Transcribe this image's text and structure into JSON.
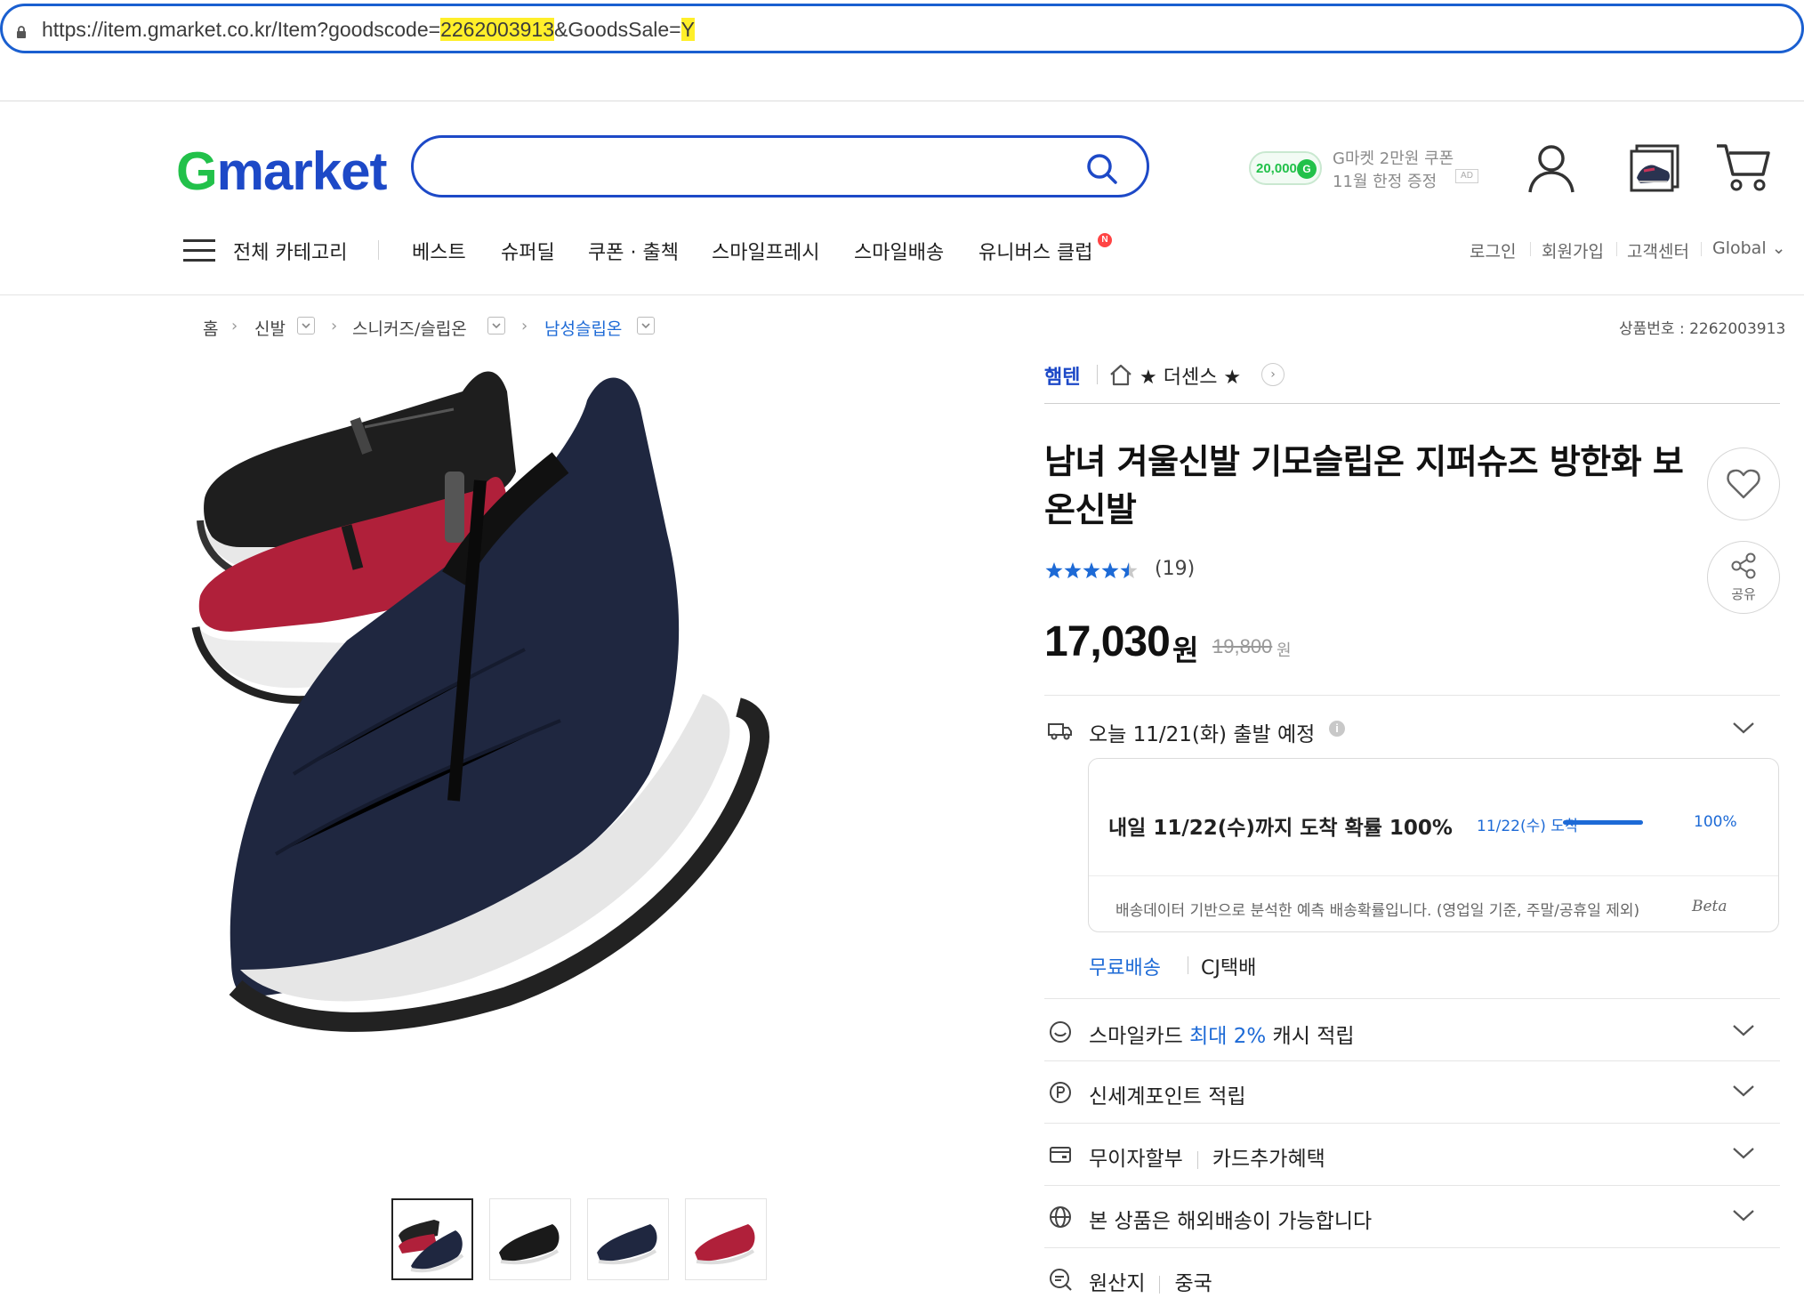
{
  "browser": {
    "url_prefix": "https://item.gmarket.co.kr/Item?goodscode=",
    "url_code": "2262003913",
    "url_mid": "&GoodsSale=",
    "url_end": "Y"
  },
  "header": {
    "logo_g": "G",
    "logo_rest": "market",
    "search_placeholder": "",
    "coupon": {
      "amount": "20,000",
      "badge": "G",
      "line1": "G마켓 2만원 쿠폰",
      "line2": "11월 한정 증정",
      "ad": "AD"
    }
  },
  "nav": {
    "all_categories": "전체 카테고리",
    "items": [
      "베스트",
      "슈퍼딜",
      "쿠폰 · 출첵",
      "스마일프레시",
      "스마일배송",
      "유니버스 클럽"
    ],
    "new_badge": "N",
    "utils": [
      "로그인",
      "회원가입",
      "고객센터",
      "Global ⌄"
    ]
  },
  "breadcrumb": {
    "home": "홈",
    "items": [
      "신발",
      "스니커즈/슬립온",
      "남성슬립온"
    ]
  },
  "product_no": "상품번호 : 2262003913",
  "product": {
    "shop_tag": "햄텐",
    "shop_name": "★ 더센스 ★",
    "title": "남녀 겨울신발 기모슬립온 지퍼슈즈 방한화 보온신발",
    "rating": 4.5,
    "review_count": "(19)",
    "price": "17,030",
    "price_unit": "원",
    "original_price": "19,800",
    "original_unit": "원",
    "share_label": "공유"
  },
  "shipping": {
    "dispatch": "오늘 11/21(화) 출발 예정",
    "info_icon": "i",
    "probability_head": "내일 11/22(수)까지 도착 확률 100%",
    "probability_sub": "11/22(수) 도착",
    "probability_value": 1.0,
    "probability_pct": "100%",
    "note": "배송데이터 기반으로 분석한 예측 배송확률입니다. (영업일 기준, 주말/공휴일 제외)",
    "beta": "Beta",
    "free": "무료배송",
    "carrier": "CJ택배"
  },
  "benefits": {
    "smilecard_a": "스마일카드 ",
    "smilecard_b": "최대 2%",
    "smilecard_c": " 캐시 적립",
    "shinsegae": "신세계포인트 적립",
    "installment_a": "무이자할부",
    "installment_b": "카드추가혜택",
    "overseas": "본 상품은 해외배송이 가능합니다",
    "origin_a": "원산지",
    "origin_b": "중국"
  },
  "thumbnails": [
    "all-colors",
    "black",
    "navy",
    "red"
  ]
}
